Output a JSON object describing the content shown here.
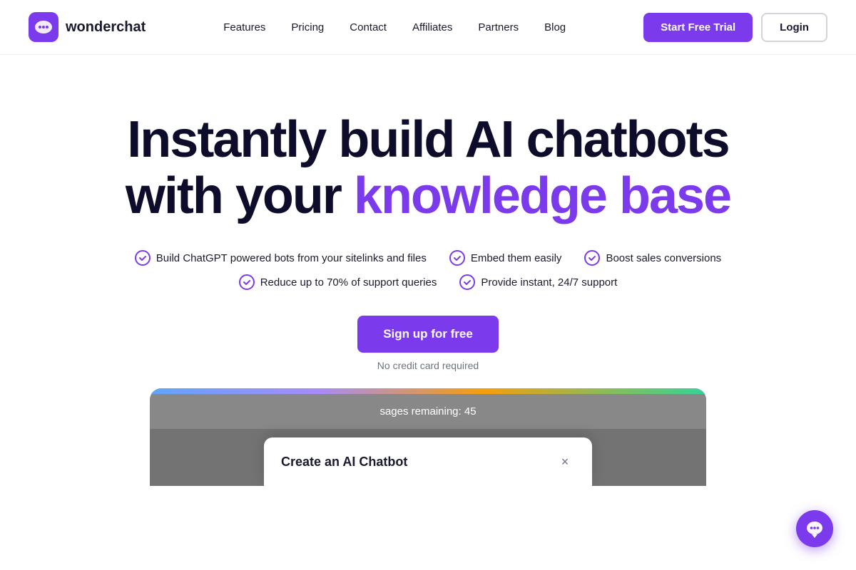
{
  "brand": {
    "name": "wonderchat",
    "logo_alt": "wonderchat logo"
  },
  "nav": {
    "links": [
      {
        "label": "Features",
        "href": "#"
      },
      {
        "label": "Pricing",
        "href": "#"
      },
      {
        "label": "Contact",
        "href": "#"
      },
      {
        "label": "Affiliates",
        "href": "#"
      },
      {
        "label": "Partners",
        "href": "#"
      },
      {
        "label": "Blog",
        "href": "#"
      }
    ],
    "cta_trial": "Start Free Trial",
    "cta_login": "Login"
  },
  "hero": {
    "title_line1": "Instantly build AI chatbots",
    "title_line2_plain": "with your ",
    "title_line2_highlight": "knowledge base",
    "features": [
      "Build ChatGPT powered bots from your sitelinks and files",
      "Embed them easily",
      "Boost sales conversions",
      "Reduce up to 70% of support queries",
      "Provide instant, 24/7 support"
    ],
    "cta_signup": "Sign up for free",
    "no_cc": "No credit card required"
  },
  "demo": {
    "messages_bar": "sages remaining: 45",
    "modal_title": "Create an AI Chatbot",
    "close_icon": "×"
  },
  "floating_chat": {
    "aria_label": "open chat"
  }
}
